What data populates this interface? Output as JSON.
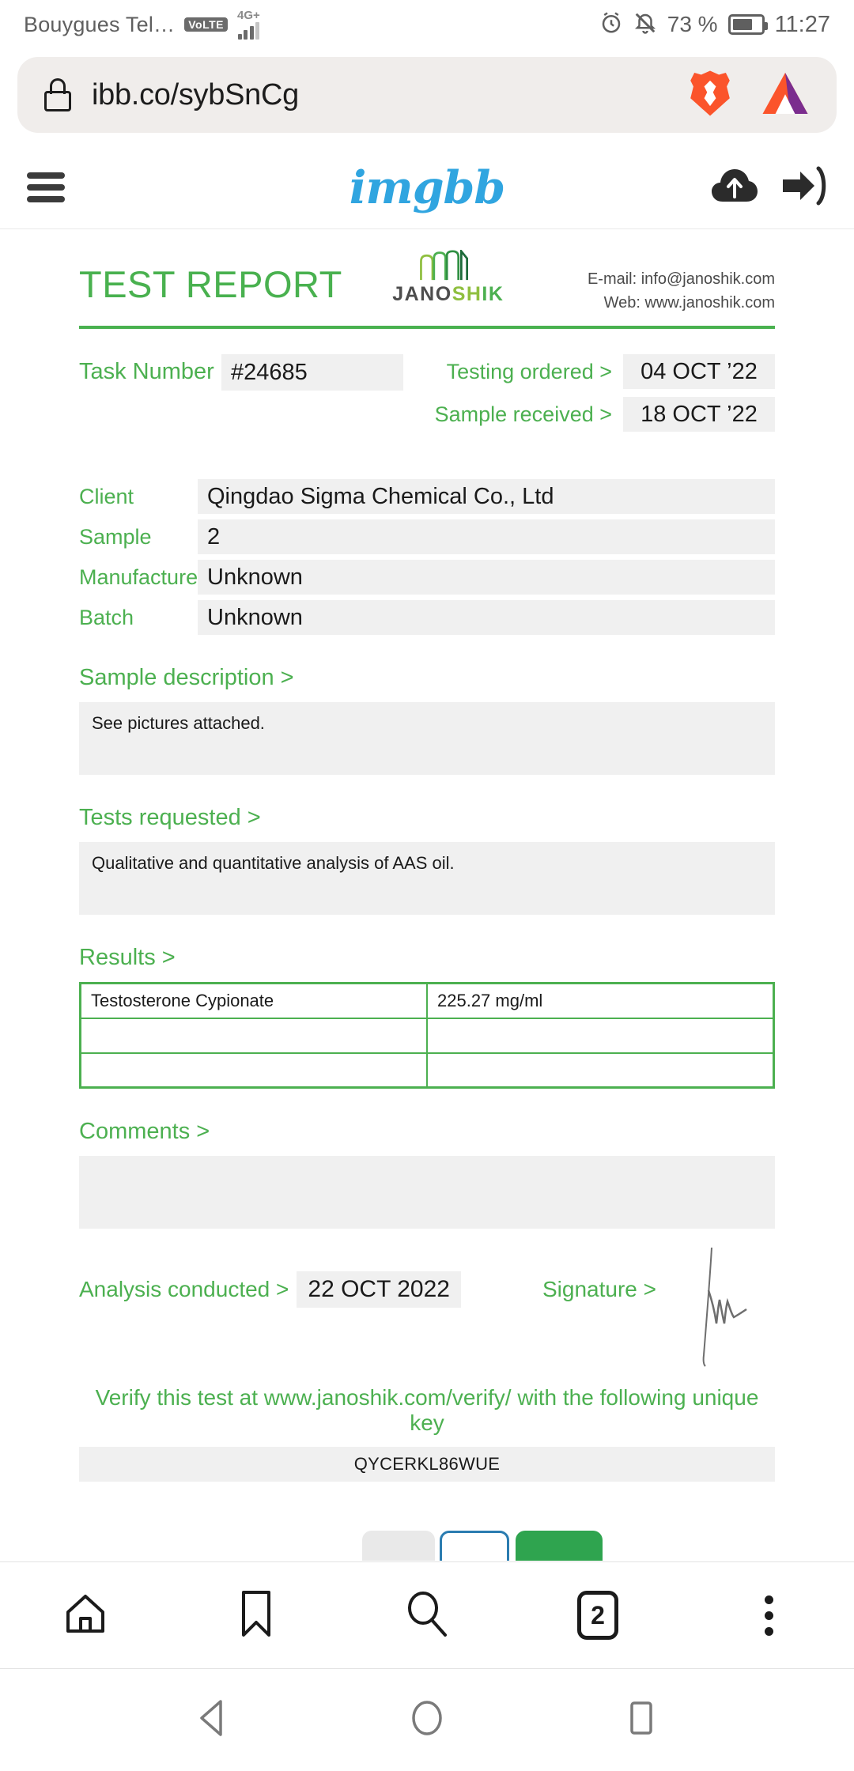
{
  "status_bar": {
    "carrier": "Bouygues Tel…",
    "volte": "VoLTE",
    "network": "4G+",
    "battery_percent": "73 %",
    "clock": "11:27"
  },
  "url_bar": {
    "url": "ibb.co/sybSnCg",
    "lock_icon": "lock-icon",
    "brave_icon": "brave-lion-icon",
    "brave_rewards_icon": "brave-rewards-triangle-icon"
  },
  "site_header": {
    "menu_icon": "hamburger-menu-icon",
    "logo_text": "imgbb",
    "logo_color": "#30a5e0",
    "upload_icon": "cloud-upload-icon",
    "signin_icon": "sign-in-icon"
  },
  "report": {
    "title": "TEST REPORT",
    "brand": {
      "part1": "JANO",
      "part2": "SH",
      "part3": "IK"
    },
    "contact": {
      "email": "E-mail: info@janoshik.com",
      "web": "Web: www.janoshik.com"
    },
    "task": {
      "label": "Task Number",
      "value": "#24685"
    },
    "dates": [
      {
        "label": "Testing ordered  >",
        "value": "04 OCT ’22"
      },
      {
        "label": "Sample received >",
        "value": "18 OCT ’22"
      }
    ],
    "info": [
      {
        "label": "Client",
        "value": "Qingdao Sigma Chemical Co., Ltd"
      },
      {
        "label": "Sample",
        "value": "2"
      },
      {
        "label": "Manufacturer",
        "value": "Unknown"
      },
      {
        "label": "Batch",
        "value": "Unknown"
      }
    ],
    "sample_description": {
      "title": "Sample description >",
      "text": "See pictures attached."
    },
    "tests_requested": {
      "title": "Tests requested >",
      "text": "Qualitative and quantitative analysis of AAS oil."
    },
    "results": {
      "title": "Results >",
      "rows": [
        {
          "substance": "Testosterone Cypionate",
          "amount": "225.27 mg/ml"
        },
        {
          "substance": "",
          "amount": ""
        },
        {
          "substance": "",
          "amount": ""
        }
      ]
    },
    "comments": {
      "title": "Comments >",
      "text": ""
    },
    "analysis": {
      "label": "Analysis conducted >",
      "value": "22 OCT 2022"
    },
    "signature": {
      "label": "Signature >",
      "icon": "handwritten-signature"
    },
    "verify": {
      "line": "Verify this test at www.janoshik.com/verify/ with the following unique key",
      "key": "QYCERKL86WUE"
    },
    "accent_color": "#4cb050"
  },
  "page_buttons": [
    {
      "name": "gray-button",
      "color": "#e9e9e9"
    },
    {
      "name": "blue-outline-button",
      "color": "#2b7cb0"
    },
    {
      "name": "green-button",
      "color": "#2fa44f"
    }
  ],
  "browser_toolbar": {
    "home_icon": "home-icon",
    "bookmarks_icon": "bookmark-icon",
    "search_icon": "search-icon",
    "tab_count": "2",
    "menu_icon": "kebab-menu-icon"
  },
  "android_nav": {
    "back_icon": "back-triangle-icon",
    "home_icon": "home-circle-icon",
    "recents_icon": "recents-square-icon"
  }
}
